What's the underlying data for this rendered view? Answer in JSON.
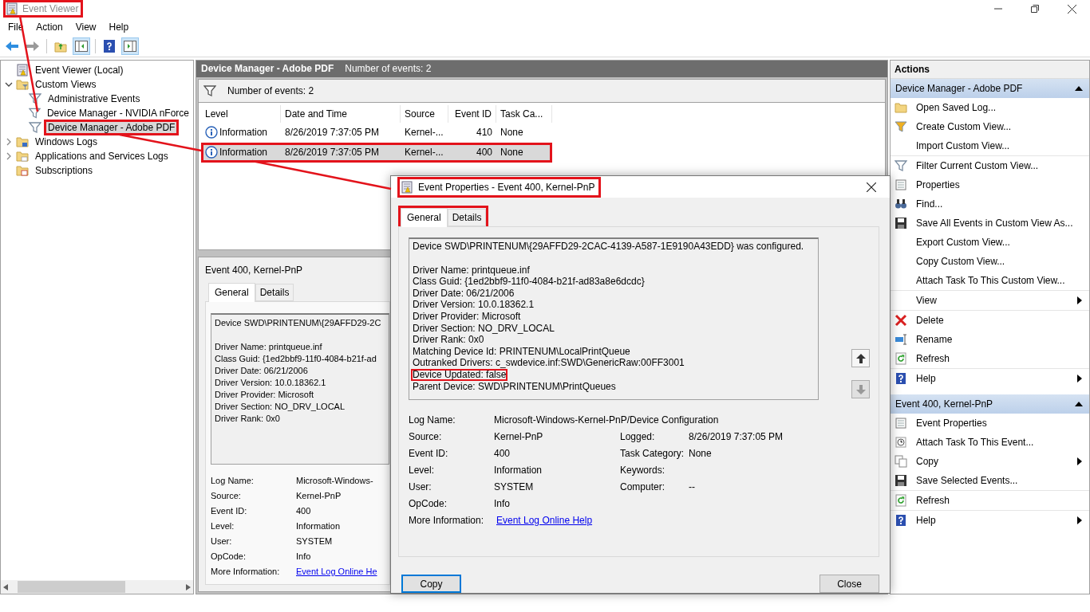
{
  "window": {
    "title": "Event Viewer",
    "highlighted": true
  },
  "menu": [
    "File",
    "Action",
    "View",
    "Help"
  ],
  "tree": [
    {
      "label": "Event Viewer (Local)",
      "kind": "log",
      "selected": false,
      "highlighted": false,
      "children": [
        {
          "label": "Custom Views",
          "kind": "folder-filter",
          "expanded": true,
          "selected": false,
          "highlighted": false,
          "children": [
            {
              "label": "Administrative Events",
              "kind": "filter",
              "selected": false,
              "highlighted": false
            },
            {
              "label": "Device Manager - NVIDIA nForce",
              "kind": "filter",
              "selected": false,
              "highlighted": false
            },
            {
              "label": "Device Manager - Adobe PDF",
              "kind": "filter",
              "selected": true,
              "highlighted": true
            }
          ]
        },
        {
          "label": "Windows Logs",
          "kind": "folder-logs",
          "expanded": false,
          "selected": false,
          "highlighted": false
        },
        {
          "label": "Applications and Services Logs",
          "kind": "folder",
          "expanded": false,
          "selected": false,
          "highlighted": false
        },
        {
          "label": "Subscriptions",
          "kind": "subscriptions",
          "selected": false,
          "highlighted": false
        }
      ]
    }
  ],
  "center": {
    "title": "Device Manager - Adobe PDF",
    "count": "Number of events: 2",
    "filter_text": "Number of events: 2",
    "columns": [
      "Level",
      "Date and Time",
      "Source",
      "Event ID",
      "Task Ca..."
    ],
    "rows": [
      {
        "level": "Information",
        "date": "8/26/2019 7:37:05 PM",
        "source": "Kernel-...",
        "event_id": "410",
        "task": "None",
        "selected": false,
        "highlighted": false
      },
      {
        "level": "Information",
        "date": "8/26/2019 7:37:05 PM",
        "source": "Kernel-...",
        "event_id": "400",
        "task": "None",
        "selected": true,
        "highlighted": true
      }
    ]
  },
  "preview": {
    "title": "Event 400, Kernel-PnP",
    "tabs": [
      {
        "label": "General",
        "selected": true
      },
      {
        "label": "Details",
        "selected": false
      }
    ],
    "paragraphs": [
      [
        "Device SWD\\PRINTENUM\\{29AFFD29-2C"
      ],
      [
        "Driver Name: printqueue.inf",
        "Class Guid: {1ed2bbf9-11f0-4084-b21f-ad",
        "Driver Date: 06/21/2006",
        "Driver Version: 10.0.18362.1",
        "Driver Provider: Microsoft",
        "Driver Section: NO_DRV_LOCAL",
        "Driver Rank: 0x0"
      ]
    ],
    "fields": [
      {
        "label": "Log Name:",
        "value": "Microsoft-Windows-"
      },
      {
        "label": "Source:",
        "value": "Kernel-PnP"
      },
      {
        "label": "Event ID:",
        "value": "400"
      },
      {
        "label": "Level:",
        "value": "Information"
      },
      {
        "label": "User:",
        "value": "SYSTEM"
      },
      {
        "label": "OpCode:",
        "value": "Info"
      },
      {
        "label": "More Information:",
        "value": "Event Log Online He",
        "kind": "link"
      }
    ]
  },
  "actions": {
    "title": "Actions",
    "sections": [
      {
        "title": "Device Manager - Adobe PDF",
        "groups": [
          [
            {
              "label": "Open Saved Log...",
              "kind": "folder",
              "submenu": false
            },
            {
              "label": "Create Custom View...",
              "kind": "filter-new",
              "submenu": false
            },
            {
              "label": "Import Custom View...",
              "kind": "none",
              "submenu": false
            }
          ],
          [
            {
              "label": "Filter Current Custom View...",
              "kind": "filter",
              "submenu": false
            },
            {
              "label": "Properties",
              "kind": "properties",
              "submenu": false
            },
            {
              "label": "Find...",
              "kind": "find",
              "submenu": false
            },
            {
              "label": "Save All Events in Custom View As...",
              "kind": "save",
              "submenu": false
            },
            {
              "label": "Export Custom View...",
              "kind": "none",
              "submenu": false
            },
            {
              "label": "Copy Custom View...",
              "kind": "none",
              "submenu": false
            },
            {
              "label": "Attach Task To This Custom View...",
              "kind": "none",
              "submenu": false
            }
          ],
          [
            {
              "label": "View",
              "kind": "none",
              "submenu": true
            }
          ],
          [
            {
              "label": "Delete",
              "kind": "delete",
              "submenu": false
            },
            {
              "label": "Rename",
              "kind": "rename",
              "submenu": false
            },
            {
              "label": "Refresh",
              "kind": "refresh",
              "submenu": false
            }
          ],
          [
            {
              "label": "Help",
              "kind": "help",
              "submenu": true
            }
          ]
        ]
      },
      {
        "title": "Event 400, Kernel-PnP",
        "groups": [
          [
            {
              "label": "Event Properties",
              "kind": "properties",
              "submenu": false
            },
            {
              "label": "Attach Task To This Event...",
              "kind": "task",
              "submenu": false
            },
            {
              "label": "Copy",
              "kind": "copy",
              "submenu": true
            },
            {
              "label": "Save Selected Events...",
              "kind": "save",
              "submenu": false
            }
          ],
          [
            {
              "label": "Refresh",
              "kind": "refresh",
              "submenu": false
            }
          ],
          [
            {
              "label": "Help",
              "kind": "help",
              "submenu": true
            }
          ]
        ]
      }
    ]
  },
  "dialog": {
    "title": "Event Properties - Event 400, Kernel-PnP",
    "highlighted": true,
    "tabs": [
      {
        "label": "General",
        "selected": true
      },
      {
        "label": "Details",
        "selected": false
      }
    ],
    "tabs_highlighted": true,
    "paragraphs": [
      [
        {
          "text": "Device SWD\\PRINTENUM\\{29AFFD29-2CAC-4139-A587-1E9190A43EDD} was configured.",
          "highlighted": false
        }
      ],
      [
        {
          "text": "Driver Name: printqueue.inf",
          "highlighted": false
        },
        {
          "text": "Class Guid: {1ed2bbf9-11f0-4084-b21f-ad83a8e6dcdc}",
          "highlighted": false
        },
        {
          "text": "Driver Date: 06/21/2006",
          "highlighted": false
        },
        {
          "text": "Driver Version: 10.0.18362.1",
          "highlighted": false
        },
        {
          "text": "Driver Provider: Microsoft",
          "highlighted": false
        },
        {
          "text": "Driver Section: NO_DRV_LOCAL",
          "highlighted": false
        },
        {
          "text": "Driver Rank: 0x0",
          "highlighted": false
        },
        {
          "text": "Matching Device Id: PRINTENUM\\LocalPrintQueue",
          "highlighted": false
        },
        {
          "text": "Outranked Drivers: c_swdevice.inf:SWD\\GenericRaw:00FF3001",
          "highlighted": false
        },
        {
          "text": "Device Updated: false",
          "highlighted": true
        },
        {
          "text": "Parent Device: SWD\\PRINTENUM\\PrintQueues",
          "highlighted": false
        }
      ]
    ],
    "fields": [
      [
        {
          "label": "Log Name:",
          "value": "Microsoft-Windows-Kernel-PnP/Device Configuration"
        }
      ],
      [
        {
          "label": "Source:",
          "value": "Kernel-PnP"
        },
        {
          "label": "Logged:",
          "value": "8/26/2019 7:37:05 PM"
        }
      ],
      [
        {
          "label": "Event ID:",
          "value": "400"
        },
        {
          "label": "Task Category:",
          "value": "None"
        }
      ],
      [
        {
          "label": "Level:",
          "value": "Information"
        },
        {
          "label": "Keywords:"
        }
      ],
      [
        {
          "label": "User:",
          "value": "SYSTEM"
        },
        {
          "label": "Computer:",
          "value": "--"
        }
      ],
      [
        {
          "label": "OpCode:",
          "value": "Info"
        }
      ],
      [
        {
          "label": "More Information:",
          "value": "Event Log Online Help",
          "kind": "link"
        }
      ]
    ],
    "buttons": [
      {
        "label": "Copy",
        "default": true
      },
      {
        "label": "Close",
        "default": false
      }
    ]
  }
}
